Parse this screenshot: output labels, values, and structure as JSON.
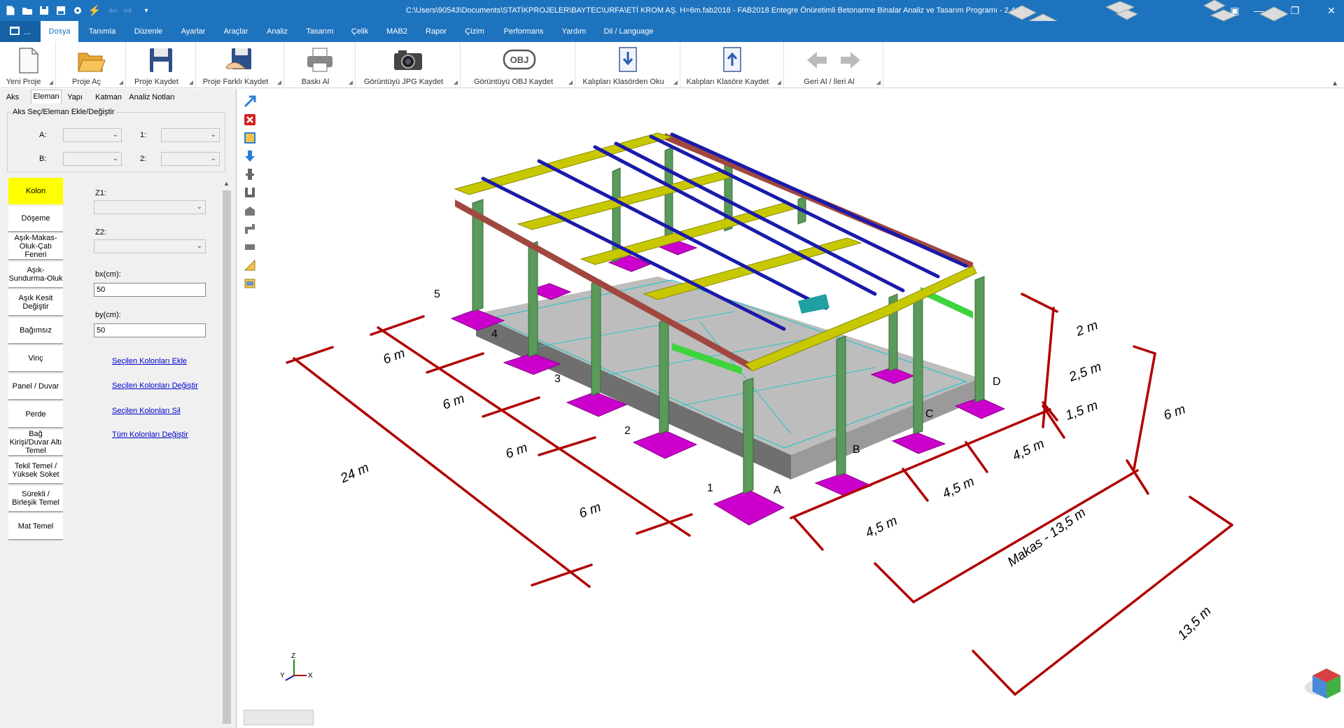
{
  "titlebar": {
    "title": "C:\\Users\\90543\\Documents\\STATİKPROJELER\\BAYTEC\\URFA\\ETİ KROM AŞ. H=6m.fab2018 - FAB2018 Entegre Önüretimli Betonarme Binalar Analiz ve Tasarım Programı  - 2.44.2"
  },
  "app_button": {
    "label": "..."
  },
  "menu": [
    "Dosya",
    "Tanımla",
    "Düzenle",
    "Ayarlar",
    "Araçlar",
    "Analiz",
    "Tasarım",
    "Çelik",
    "MAB2",
    "Rapor",
    "Çizim",
    "Performans",
    "Yardım",
    "Dil / Language"
  ],
  "ribbon": [
    {
      "label": "Yeni Proje",
      "icon": "new-file-icon"
    },
    {
      "label": "Proje Aç",
      "icon": "open-folder-icon"
    },
    {
      "label": "Proje Kaydet",
      "icon": "save-icon"
    },
    {
      "label": "Proje Farklı Kaydet",
      "icon": "save-as-icon"
    },
    {
      "label": "Baskı Al",
      "icon": "printer-icon"
    },
    {
      "label": "Görüntüyü JPG Kaydet",
      "icon": "camera-icon"
    },
    {
      "label": "Görüntüyü OBJ Kaydet",
      "icon": "obj-icon",
      "icon_text": "OBJ"
    },
    {
      "label": "Kalıpları Klasörden Oku",
      "icon": "import-icon"
    },
    {
      "label": "Kalıpları Klasöre Kaydet",
      "icon": "export-icon"
    },
    {
      "label": "Geri Al / İleri Al",
      "icon": "undo-redo-icon"
    }
  ],
  "tabs": [
    "Aks",
    "Eleman",
    "Yapı",
    "Katman",
    "Analiz Notları"
  ],
  "active_tab": "Eleman",
  "axis_select": {
    "title": "Aks Seç/Eleman Ekle/Değiştir",
    "label_a": "A:",
    "label_b": "B:",
    "label_1": "1:",
    "label_2": "2:"
  },
  "side_buttons": [
    "Kolon",
    "Döşeme",
    "Aşık-Makas-Oluk-Çatı Feneri",
    "Aşık-Sundurma-Oluk",
    "Aşık Kesit Değiştir",
    "Bağımsız",
    "Vinç",
    "Panel / Duvar",
    "Perde",
    "Bağ Kirişi/Duvar Altı Temel",
    "Tekil Temel / Yüksek Soket",
    "Sürekli / Birleşik Temel",
    "Mat Temel"
  ],
  "column_form": {
    "z1_label": "Z1:",
    "z2_label": "Z2:",
    "bx_label": "bx(cm):",
    "bx_value": "50",
    "by_label": "by(cm):",
    "by_value": "50",
    "links": [
      "Seçilen Kolonları Ekle",
      "Seçilen Kolonları Değiştir",
      "Seçilen Kolonları Sil",
      "Tüm Kolonları Değiştir"
    ]
  },
  "viewport": {
    "axis_numbers": [
      "1",
      "2",
      "3",
      "4",
      "5"
    ],
    "axis_letters": [
      "A",
      "B",
      "C",
      "D"
    ],
    "dim_long_segments": [
      "6 m",
      "6 m",
      "6 m",
      "6 m"
    ],
    "dim_long_total": "24 m",
    "dim_short_segments": [
      "4,5 m",
      "4,5 m",
      "4,5 m"
    ],
    "dim_truss": "Makas - 13,5 m",
    "dim_short_total": "13,5 m",
    "dim_heights": [
      "2 m",
      "2,5 m",
      "1,5 m"
    ],
    "dim_height_total": "6 m",
    "triad": {
      "z": "Z",
      "y": "Y",
      "x": "X"
    }
  },
  "colors": {
    "titlebar": "#1e73be",
    "column": "#5a9a5a",
    "footing": "#cc00cc",
    "truss": "#c8c800",
    "purlin": "#1a1aaa",
    "edge_beam": "#a04840",
    "ground_beam": "#808080",
    "dimension": "#b00000",
    "active_button": "#ffff00"
  }
}
